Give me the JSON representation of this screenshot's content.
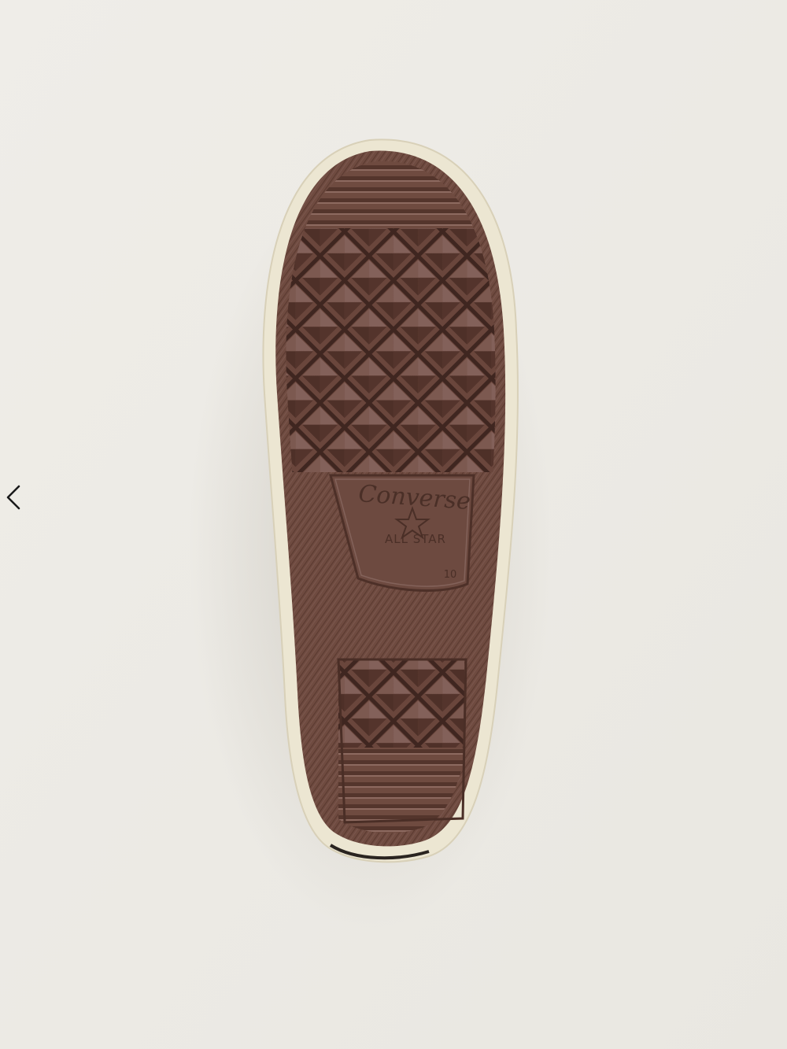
{
  "viewer": {
    "background_color": "#edebe6",
    "prev_icon": "chevron-left-icon"
  },
  "product_image": {
    "description_icon": "shoe-outsole-photo",
    "outsole_color": "#6e4a40",
    "foxing_color": "#ece6d2",
    "upper_color": "#2b2622",
    "brand_logo_text": "Converse",
    "brand_logo_subtext": "ALL STAR",
    "size_mark": "10"
  }
}
